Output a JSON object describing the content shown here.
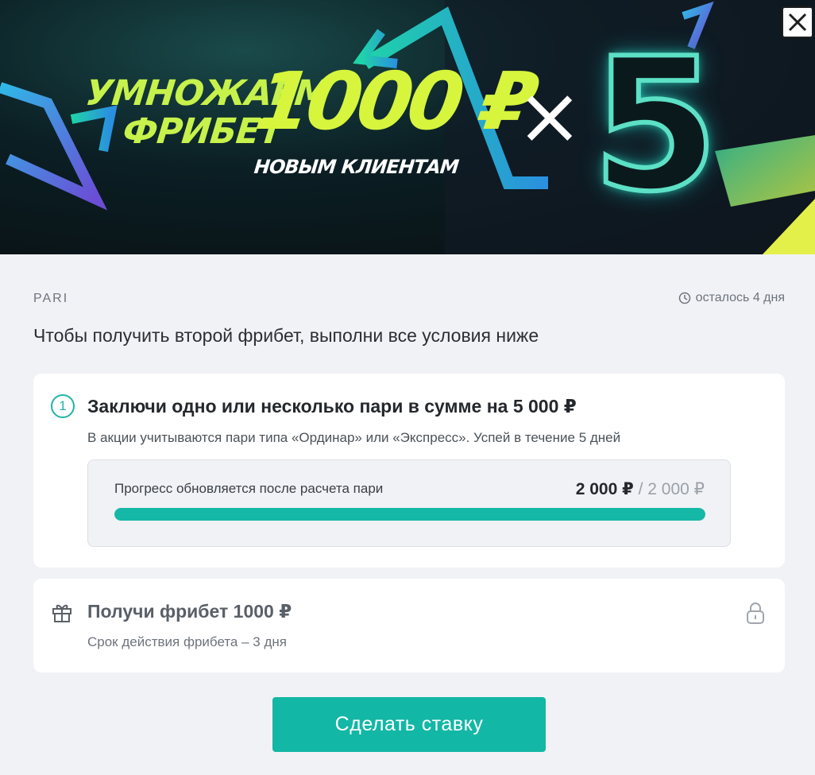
{
  "banner": {
    "line1": "УМНОЖАЕМ",
    "line2": "ФРИБЕТ",
    "amount": "1000 ₽",
    "subtitle": "НОВЫМ КЛИЕНТАМ",
    "times": "×",
    "multiplier": "5",
    "close_icon": "close-icon"
  },
  "header": {
    "brand": "PARI",
    "remaining": "осталось 4 дня",
    "remaining_icon": "clock-icon"
  },
  "headline": "Чтобы получить второй фрибет, выполни все условия ниже",
  "step": {
    "number": "1",
    "title": "Заключи одно или несколько пари в сумме на 5 000 ₽",
    "description": "В акции учитываются пари типа «Ординар» или «Экспресс». Успей в течение 5 дней",
    "progress": {
      "note": "Прогресс обновляется после расчета пари",
      "current": "2 000 ₽",
      "separator": " / ",
      "total": "2 000 ₽",
      "fraction": 1.0
    }
  },
  "reward": {
    "icon": "gift-icon",
    "title": "Получи фрибет 1000 ₽",
    "description": "Срок действия фрибета – 3 дня",
    "status_icon": "lock-icon"
  },
  "action": {
    "button_label": "Сделать ставку"
  },
  "colors": {
    "accent": "#13b7a5",
    "banner_text": "#d6f53c",
    "background": "#f1f2f6"
  }
}
